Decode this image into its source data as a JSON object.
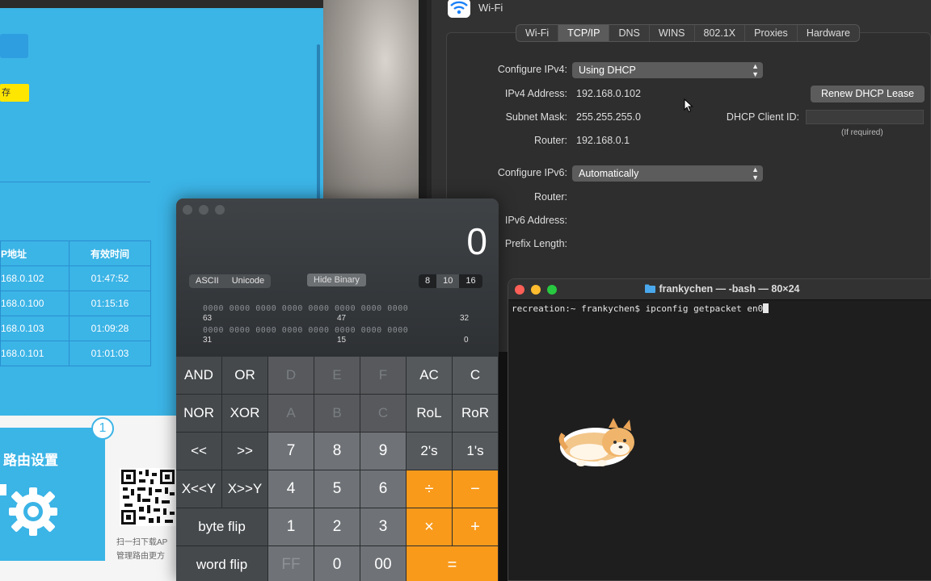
{
  "router_page": {
    "yellow_button": "存",
    "table": {
      "headers": [
        "P地址",
        "有效时间"
      ],
      "rows": [
        [
          "168.0.102",
          "01:47:52"
        ],
        [
          "168.0.100",
          "01:15:16"
        ],
        [
          "168.0.103",
          "01:09:28"
        ],
        [
          "168.0.101",
          "01:01:03"
        ]
      ]
    },
    "card_badge": "1",
    "card_title": "路由设置",
    "qr_caption_1": "扫一扫下载AP",
    "qr_caption_2": "管理路由更方"
  },
  "network": {
    "title": "Wi-Fi",
    "tabs": [
      "Wi-Fi",
      "TCP/IP",
      "DNS",
      "WINS",
      "802.1X",
      "Proxies",
      "Hardware"
    ],
    "active_tab": "TCP/IP",
    "configure_ipv4_label": "Configure IPv4:",
    "configure_ipv4_value": "Using DHCP",
    "ipv4_address_label": "IPv4 Address:",
    "ipv4_address": "192.168.0.102",
    "subnet_mask_label": "Subnet Mask:",
    "subnet_mask": "255.255.255.0",
    "router_label": "Router:",
    "router": "192.168.0.1",
    "renew_button": "Renew DHCP Lease",
    "dhcp_client_id_label": "DHCP Client ID:",
    "dhcp_client_id_value": "",
    "if_required": "(If required)",
    "configure_ipv6_label": "Configure IPv6:",
    "configure_ipv6_value": "Automatically",
    "router6_label": "Router:",
    "ipv6_address_label": "IPv6 Address:",
    "prefix_length_label": "Prefix Length:"
  },
  "calculator": {
    "display": "0",
    "encoding": [
      "ASCII",
      "Unicode"
    ],
    "hide_binary": "Hide Binary",
    "bases": [
      "8",
      "10",
      "16"
    ],
    "selected_base": "10",
    "bits_row": "0000 0000 0000 0000 0000 0000 0000 0000",
    "bit_labels_top": [
      "63",
      "47",
      "32"
    ],
    "bit_labels_bottom": [
      "31",
      "15",
      "0"
    ],
    "keys": [
      [
        "AND",
        "OR",
        "D",
        "E",
        "F",
        "AC",
        "C"
      ],
      [
        "NOR",
        "XOR",
        "A",
        "B",
        "C",
        "RoL",
        "RoR"
      ],
      [
        "<<",
        ">>",
        "7",
        "8",
        "9",
        "2's",
        "1's"
      ],
      [
        "X<<Y",
        "X>>Y",
        "4",
        "5",
        "6",
        "÷",
        "−"
      ],
      [
        "byte flip",
        "1",
        "2",
        "3",
        "×",
        "+"
      ],
      [
        "word flip",
        "FF",
        "0",
        "00",
        "="
      ]
    ]
  },
  "terminal": {
    "title": "frankychen — -bash — 80×24",
    "prompt": "recreation:~ frankychen$ ipconfig getpacket en0"
  },
  "colors": {
    "router_blue": "#3bb4e6",
    "calc_orange": "#f99a1b",
    "close_red": "#ff5f57",
    "min_yellow": "#febc2e",
    "max_green": "#28c840"
  }
}
